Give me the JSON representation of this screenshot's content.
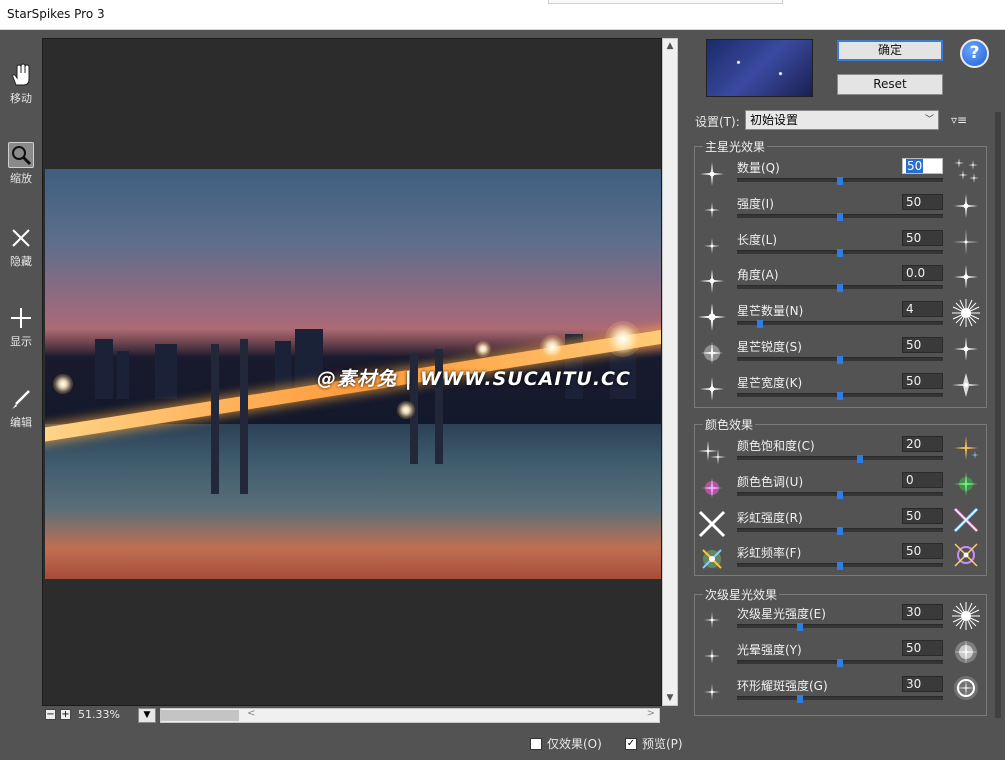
{
  "window": {
    "title": "StarSpikes Pro 3"
  },
  "tools": [
    {
      "label": "移动",
      "icon": "hand-icon"
    },
    {
      "label": "缩放",
      "icon": "magnifier-icon"
    },
    {
      "label": "隐藏",
      "icon": "x-mark-icon"
    },
    {
      "label": "显示",
      "icon": "plus-icon"
    },
    {
      "label": "编辑",
      "icon": "brush-icon"
    }
  ],
  "preview": {
    "watermark": "@素材兔  |  WWW.SUCAITU.CC"
  },
  "status": {
    "zoom": "51.33%"
  },
  "options": {
    "effect_only": "仅效果(O)",
    "effect_only_checked": false,
    "preview": "预览(P)",
    "preview_checked": true
  },
  "buttons": {
    "ok": "确定",
    "reset": "Reset",
    "help": "?"
  },
  "settings": {
    "label": "设置(T):",
    "value": "初始设置"
  },
  "groups": {
    "main": {
      "title": "主星光效果",
      "rows": [
        {
          "label": "数量(Q)",
          "value": "50",
          "slider": 0.5
        },
        {
          "label": "强度(I)",
          "value": "50",
          "slider": 0.5
        },
        {
          "label": "长度(L)",
          "value": "50",
          "slider": 0.5
        },
        {
          "label": "角度(A)",
          "value": "0.0",
          "slider": 0.5
        },
        {
          "label": "星芒数量(N)",
          "value": "4",
          "slider": 0.1
        },
        {
          "label": "星芒锐度(S)",
          "value": "50",
          "slider": 0.5
        },
        {
          "label": "星芒宽度(K)",
          "value": "50",
          "slider": 0.5
        }
      ]
    },
    "color": {
      "title": "颜色效果",
      "rows": [
        {
          "label": "颜色饱和度(C)",
          "value": "20",
          "slider": 0.6
        },
        {
          "label": "颜色色调(U)",
          "value": "0",
          "slider": 0.5
        },
        {
          "label": "彩虹强度(R)",
          "value": "50",
          "slider": 0.5
        },
        {
          "label": "彩虹频率(F)",
          "value": "50",
          "slider": 0.5
        }
      ]
    },
    "secondary": {
      "title": "次级星光效果",
      "rows": [
        {
          "label": "次级星光强度(E)",
          "value": "30",
          "slider": 0.3
        },
        {
          "label": "光晕强度(Y)",
          "value": "50",
          "slider": 0.5
        },
        {
          "label": "环形耀斑强度(G)",
          "value": "30",
          "slider": 0.3
        }
      ]
    }
  }
}
